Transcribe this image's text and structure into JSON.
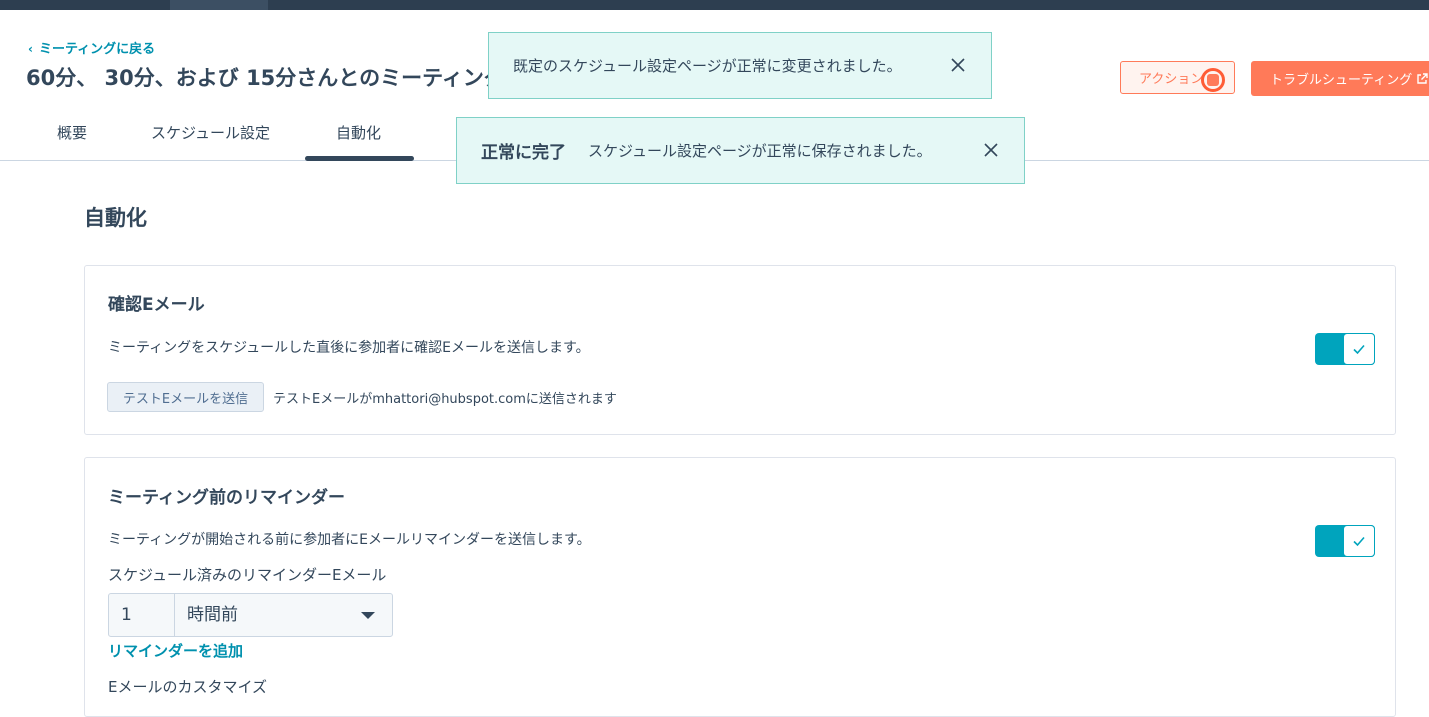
{
  "header": {
    "back_link": "ミーティングに戻る",
    "title": "60分、 30分、および 15分さんとのミーティング",
    "actions_label": "アクション",
    "troubleshoot_label": "トラブルシューティング"
  },
  "tabs": [
    {
      "label": "概要",
      "active": false
    },
    {
      "label": "スケジュール設定",
      "active": false
    },
    {
      "label": "自動化",
      "active": true
    }
  ],
  "toasts": [
    {
      "title": "",
      "message": "既定のスケジュール設定ページが正常に変更されました。"
    },
    {
      "title": "正常に完了",
      "message": "スケジュール設定ページが正常に保存されました。"
    }
  ],
  "section_title": "自動化",
  "confirmation_email": {
    "title": "確認Eメール",
    "description": "ミーティングをスケジュールした直後に参加者に確認Eメールを送信します。",
    "enabled": true,
    "test_button": "テストEメールを送信",
    "test_note": "テストEメールがmhattori@hubspot.comに送信されます"
  },
  "reminder": {
    "title": "ミーティング前のリマインダー",
    "description": "ミーティングが開始される前に参加者にEメールリマインダーを送信します。",
    "enabled": true,
    "scheduled_label": "スケジュール済みのリマインダーEメール",
    "amount": "1",
    "unit": "時間前",
    "add_link": "リマインダーを追加",
    "customize_label": "Eメールのカスタマイズ"
  },
  "colors": {
    "accent": "#0091ae",
    "primary_button": "#ff7a59",
    "toggle_on": "#00a4bd",
    "toast_bg": "#e5f8f6"
  }
}
